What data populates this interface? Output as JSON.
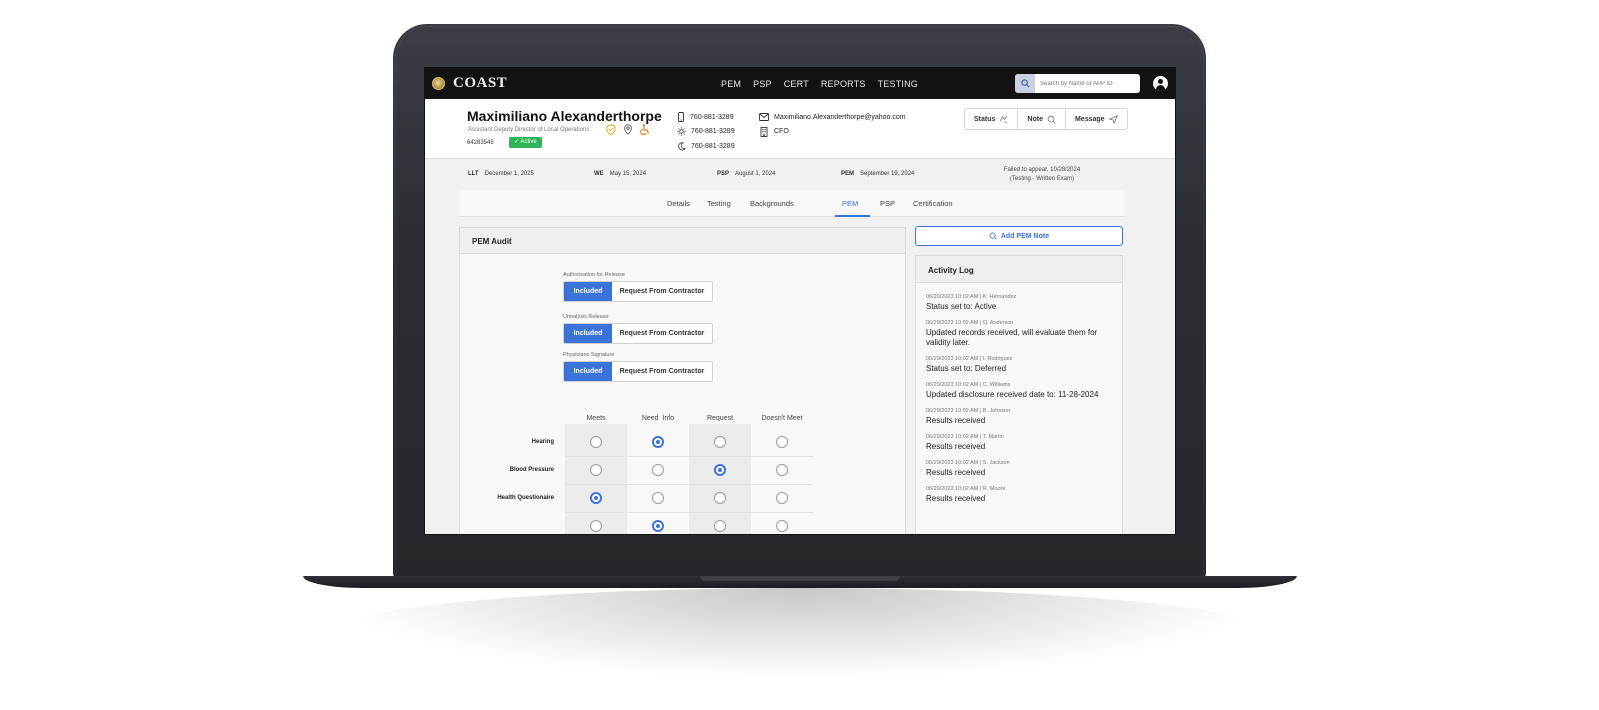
{
  "app": {
    "brand": "COAST",
    "nav": [
      "PEM",
      "PSP",
      "CERT",
      "REPORTS",
      "TESTING"
    ],
    "search_placeholder": "Search by Name or APP ID"
  },
  "profile": {
    "name": "Maximiliano Alexanderthorpe",
    "title": "Assistant Deputy Director of Local Operations",
    "app_id": "64283545",
    "status": "✓ Active",
    "phones": [
      "760-881-3289",
      "760-881-3289",
      "760-881-3289"
    ],
    "email": "Maximiliano.Alexanderthorpe@yahoo.com",
    "role": "CFO",
    "actions": [
      "Status",
      "Note",
      "Message"
    ]
  },
  "dates": {
    "llt": {
      "label": "LLT",
      "value": "December 1, 2025"
    },
    "we": {
      "label": "WE",
      "value": "May 15, 2024"
    },
    "psp": {
      "label": "PSP",
      "value": "August 1, 2024"
    },
    "pem": {
      "label": "PEM",
      "value": "September 19, 2024"
    },
    "note_line1": "Failed to appear, 10/28/2024",
    "note_line2": "(Testing - Written Exam)"
  },
  "tabs": [
    "Details",
    "Testing",
    "Backgrounds",
    "PEM",
    "PSP",
    "Certification"
  ],
  "active_tab": "PEM",
  "audit": {
    "title": "PEM Audit",
    "fields": [
      {
        "label": "Authorization for Release",
        "selected": "Included",
        "other": "Request From Contractor"
      },
      {
        "label": "Urinalysis Release",
        "selected": "Included",
        "other": "Request From Contractor"
      },
      {
        "label": "Physicians Signature",
        "selected": "Included",
        "other": "Request From Contractor"
      }
    ],
    "columns": [
      "Meets",
      "Need  Info",
      "Request",
      "Doesn't Meet"
    ],
    "rows": [
      {
        "label": "Hearing",
        "selected": 1
      },
      {
        "label": "Blood Pressure",
        "selected": 2
      },
      {
        "label": "Health Questionaire",
        "selected": 0
      },
      {
        "label": "",
        "selected": 1
      }
    ]
  },
  "right": {
    "add_note": "Add PEM Note",
    "log_title": "Activity Log",
    "entries": [
      {
        "meta": "06/29/2023 10:02 AM  |  K. Hernandez",
        "text": "Status set to: Active"
      },
      {
        "meta": "06/29/2023 10:02 AM  |  O. Anderson",
        "text": "Updated records received, will evaluate them for validity later."
      },
      {
        "meta": "06/29/2023 10:02 AM  |  I. Rodriguez",
        "text": "Status set to: Deferred"
      },
      {
        "meta": "06/29/2023 10:02 AM  |  C. Williams",
        "text": "Updated disclosure received date to: 11-28-2024"
      },
      {
        "meta": "06/29/2023 10:02 AM  |  B. Johnson",
        "text": "Results received"
      },
      {
        "meta": "06/29/2023 10:02 AM  |  T. Martin",
        "text": "Results received"
      },
      {
        "meta": "06/29/2023 10:02 AM  |  S. Jackson",
        "text": "Results received"
      },
      {
        "meta": "06/29/2023 10:02 AM  |  R. Moore",
        "text": "Results received"
      }
    ]
  },
  "colors": {
    "accent": "#3b73d8",
    "active": "#2fb457",
    "topbar": "#121212"
  }
}
